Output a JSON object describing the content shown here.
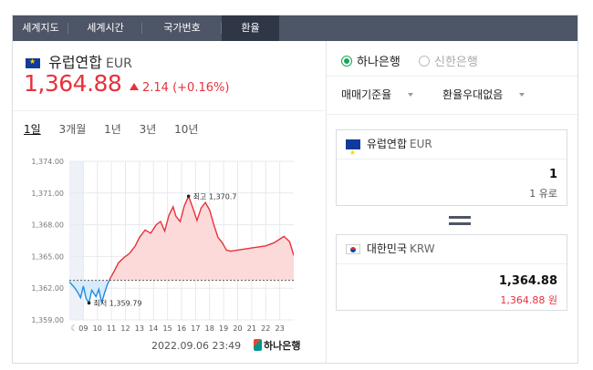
{
  "tabs": [
    {
      "label": "세계지도",
      "active": false
    },
    {
      "label": "세계시간",
      "active": false
    },
    {
      "label": "국가번호",
      "active": false
    },
    {
      "label": "환율",
      "active": true
    }
  ],
  "currency": {
    "name": "유럽연합",
    "code": "EUR",
    "flag": "eu-flag-icon"
  },
  "price": "1,364.88",
  "change": {
    "direction": "up",
    "amount": "2.14",
    "percent": "(+0.16%)"
  },
  "periods": [
    "1일",
    "3개월",
    "1년",
    "3년",
    "10년"
  ],
  "selected_period": "1일",
  "chart_data": {
    "type": "area",
    "y_ticks": [
      "1,374.00",
      "1,371.00",
      "1,368.00",
      "1,365.00",
      "1,362.00",
      "1,359.00"
    ],
    "ylim": [
      1359,
      1374
    ],
    "x_ticks": [
      "09",
      "10",
      "11",
      "12",
      "13",
      "14",
      "15",
      "16",
      "17",
      "18",
      "19",
      "20",
      "21",
      "22",
      "23"
    ],
    "reference_line": 1362.74,
    "high_label": "최고 1,370.7",
    "low_label": "최저 1,359.79",
    "series": [
      {
        "hour": 8.0,
        "value": 1362.6
      },
      {
        "hour": 8.4,
        "value": 1362.0
      },
      {
        "hour": 8.6,
        "value": 1361.6
      },
      {
        "hour": 8.8,
        "value": 1361.1
      },
      {
        "hour": 9.0,
        "value": 1362.2
      },
      {
        "hour": 9.2,
        "value": 1361.0
      },
      {
        "hour": 9.4,
        "value": 1360.6
      },
      {
        "hour": 9.6,
        "value": 1361.8
      },
      {
        "hour": 9.9,
        "value": 1361.2
      },
      {
        "hour": 10.1,
        "value": 1361.9
      },
      {
        "hour": 10.3,
        "value": 1360.6
      },
      {
        "hour": 10.5,
        "value": 1361.5
      },
      {
        "hour": 10.7,
        "value": 1362.3
      },
      {
        "hour": 10.9,
        "value": 1362.9
      },
      {
        "hour": 11.2,
        "value": 1363.6
      },
      {
        "hour": 11.5,
        "value": 1364.4
      },
      {
        "hour": 11.9,
        "value": 1364.9
      },
      {
        "hour": 12.3,
        "value": 1365.3
      },
      {
        "hour": 12.7,
        "value": 1366.0
      },
      {
        "hour": 13.0,
        "value": 1366.8
      },
      {
        "hour": 13.4,
        "value": 1367.5
      },
      {
        "hour": 13.8,
        "value": 1367.2
      },
      {
        "hour": 14.2,
        "value": 1368.0
      },
      {
        "hour": 14.5,
        "value": 1368.3
      },
      {
        "hour": 14.8,
        "value": 1367.4
      },
      {
        "hour": 15.1,
        "value": 1368.9
      },
      {
        "hour": 15.4,
        "value": 1369.7
      },
      {
        "hour": 15.6,
        "value": 1368.8
      },
      {
        "hour": 15.9,
        "value": 1368.3
      },
      {
        "hour": 16.2,
        "value": 1369.8
      },
      {
        "hour": 16.5,
        "value": 1370.7
      },
      {
        "hour": 16.8,
        "value": 1369.6
      },
      {
        "hour": 17.1,
        "value": 1368.4
      },
      {
        "hour": 17.4,
        "value": 1369.6
      },
      {
        "hour": 17.7,
        "value": 1370.1
      },
      {
        "hour": 18.0,
        "value": 1369.4
      },
      {
        "hour": 18.3,
        "value": 1368.0
      },
      {
        "hour": 18.6,
        "value": 1366.8
      },
      {
        "hour": 18.9,
        "value": 1366.3
      },
      {
        "hour": 19.2,
        "value": 1365.6
      },
      {
        "hour": 19.5,
        "value": 1365.5
      },
      {
        "hour": 20.0,
        "value": 1365.6
      },
      {
        "hour": 21.0,
        "value": 1365.8
      },
      {
        "hour": 22.0,
        "value": 1366.0
      },
      {
        "hour": 22.6,
        "value": 1366.3
      },
      {
        "hour": 23.3,
        "value": 1366.9
      },
      {
        "hour": 23.7,
        "value": 1366.4
      },
      {
        "hour": 24.0,
        "value": 1365.1
      }
    ],
    "colors": {
      "up": "#e8313c",
      "down": "#1e8ce6",
      "fill_up": "#fcdada",
      "fill_down": "#d7ebfc",
      "grid": "#e6e9ed",
      "reference": "#555555"
    }
  },
  "timestamp": "2022.09.06 23:49",
  "bank_logo_text": "하나은행",
  "banks": [
    {
      "label": "하나은행",
      "selected": true
    },
    {
      "label": "신한은행",
      "selected": false
    }
  ],
  "filters": [
    {
      "label": "매매기준율"
    },
    {
      "label": "환율우대없음"
    }
  ],
  "converter": {
    "from": {
      "name": "유럽연합",
      "code": "EUR",
      "amount": "1",
      "unit": "1 유로"
    },
    "to": {
      "name": "대한민국",
      "code": "KRW",
      "amount": "1,364.88",
      "unit": "1,364.88 원"
    }
  }
}
